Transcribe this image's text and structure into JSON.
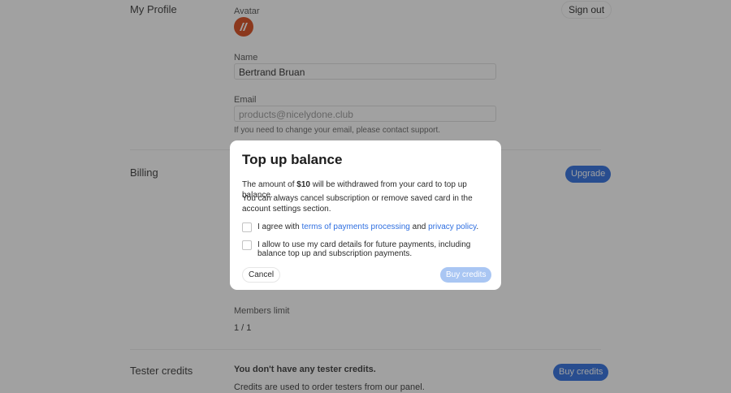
{
  "profile": {
    "section_label": "My Profile",
    "sign_out_label": "Sign out",
    "avatar_label": "Avatar",
    "name_label": "Name",
    "name_value": "Bertrand Bruan",
    "email_label": "Email",
    "email_value": "products@nicelydone.club",
    "email_help": "If you need to change your email, please contact support."
  },
  "billing": {
    "section_label": "Billing",
    "upgrade_label": "Upgrade",
    "members_limit_label": "Members limit",
    "members_limit_value": "1 / 1"
  },
  "tester_credits": {
    "section_label": "Tester credits",
    "buy_label": "Buy credits",
    "headline": "You don't have any tester credits.",
    "description": "Credits are used to order testers from our panel."
  },
  "modal": {
    "title": "Top up balance",
    "amount_text_before": "The amount of ",
    "amount": "$10",
    "amount_text_after": " will be withdrawed from your card to top up balance.",
    "cancel_info": "You can always cancel subscription or remove saved card in the account settings section.",
    "agree_prefix": "I agree with ",
    "terms_link": "terms of payments processing",
    "agree_middle": " and ",
    "privacy_link": "privacy policy",
    "agree_suffix": ".",
    "allow_text": "I allow to use my card details for future payments, including balance top up and subscription payments.",
    "cancel_label": "Cancel",
    "buy_label": "Buy credits",
    "terms_checked": false,
    "allow_checked": false
  },
  "colors": {
    "primary": "#2f6fe0",
    "primary_disabled": "#a9c6f3",
    "avatar": "#d94a1c"
  }
}
